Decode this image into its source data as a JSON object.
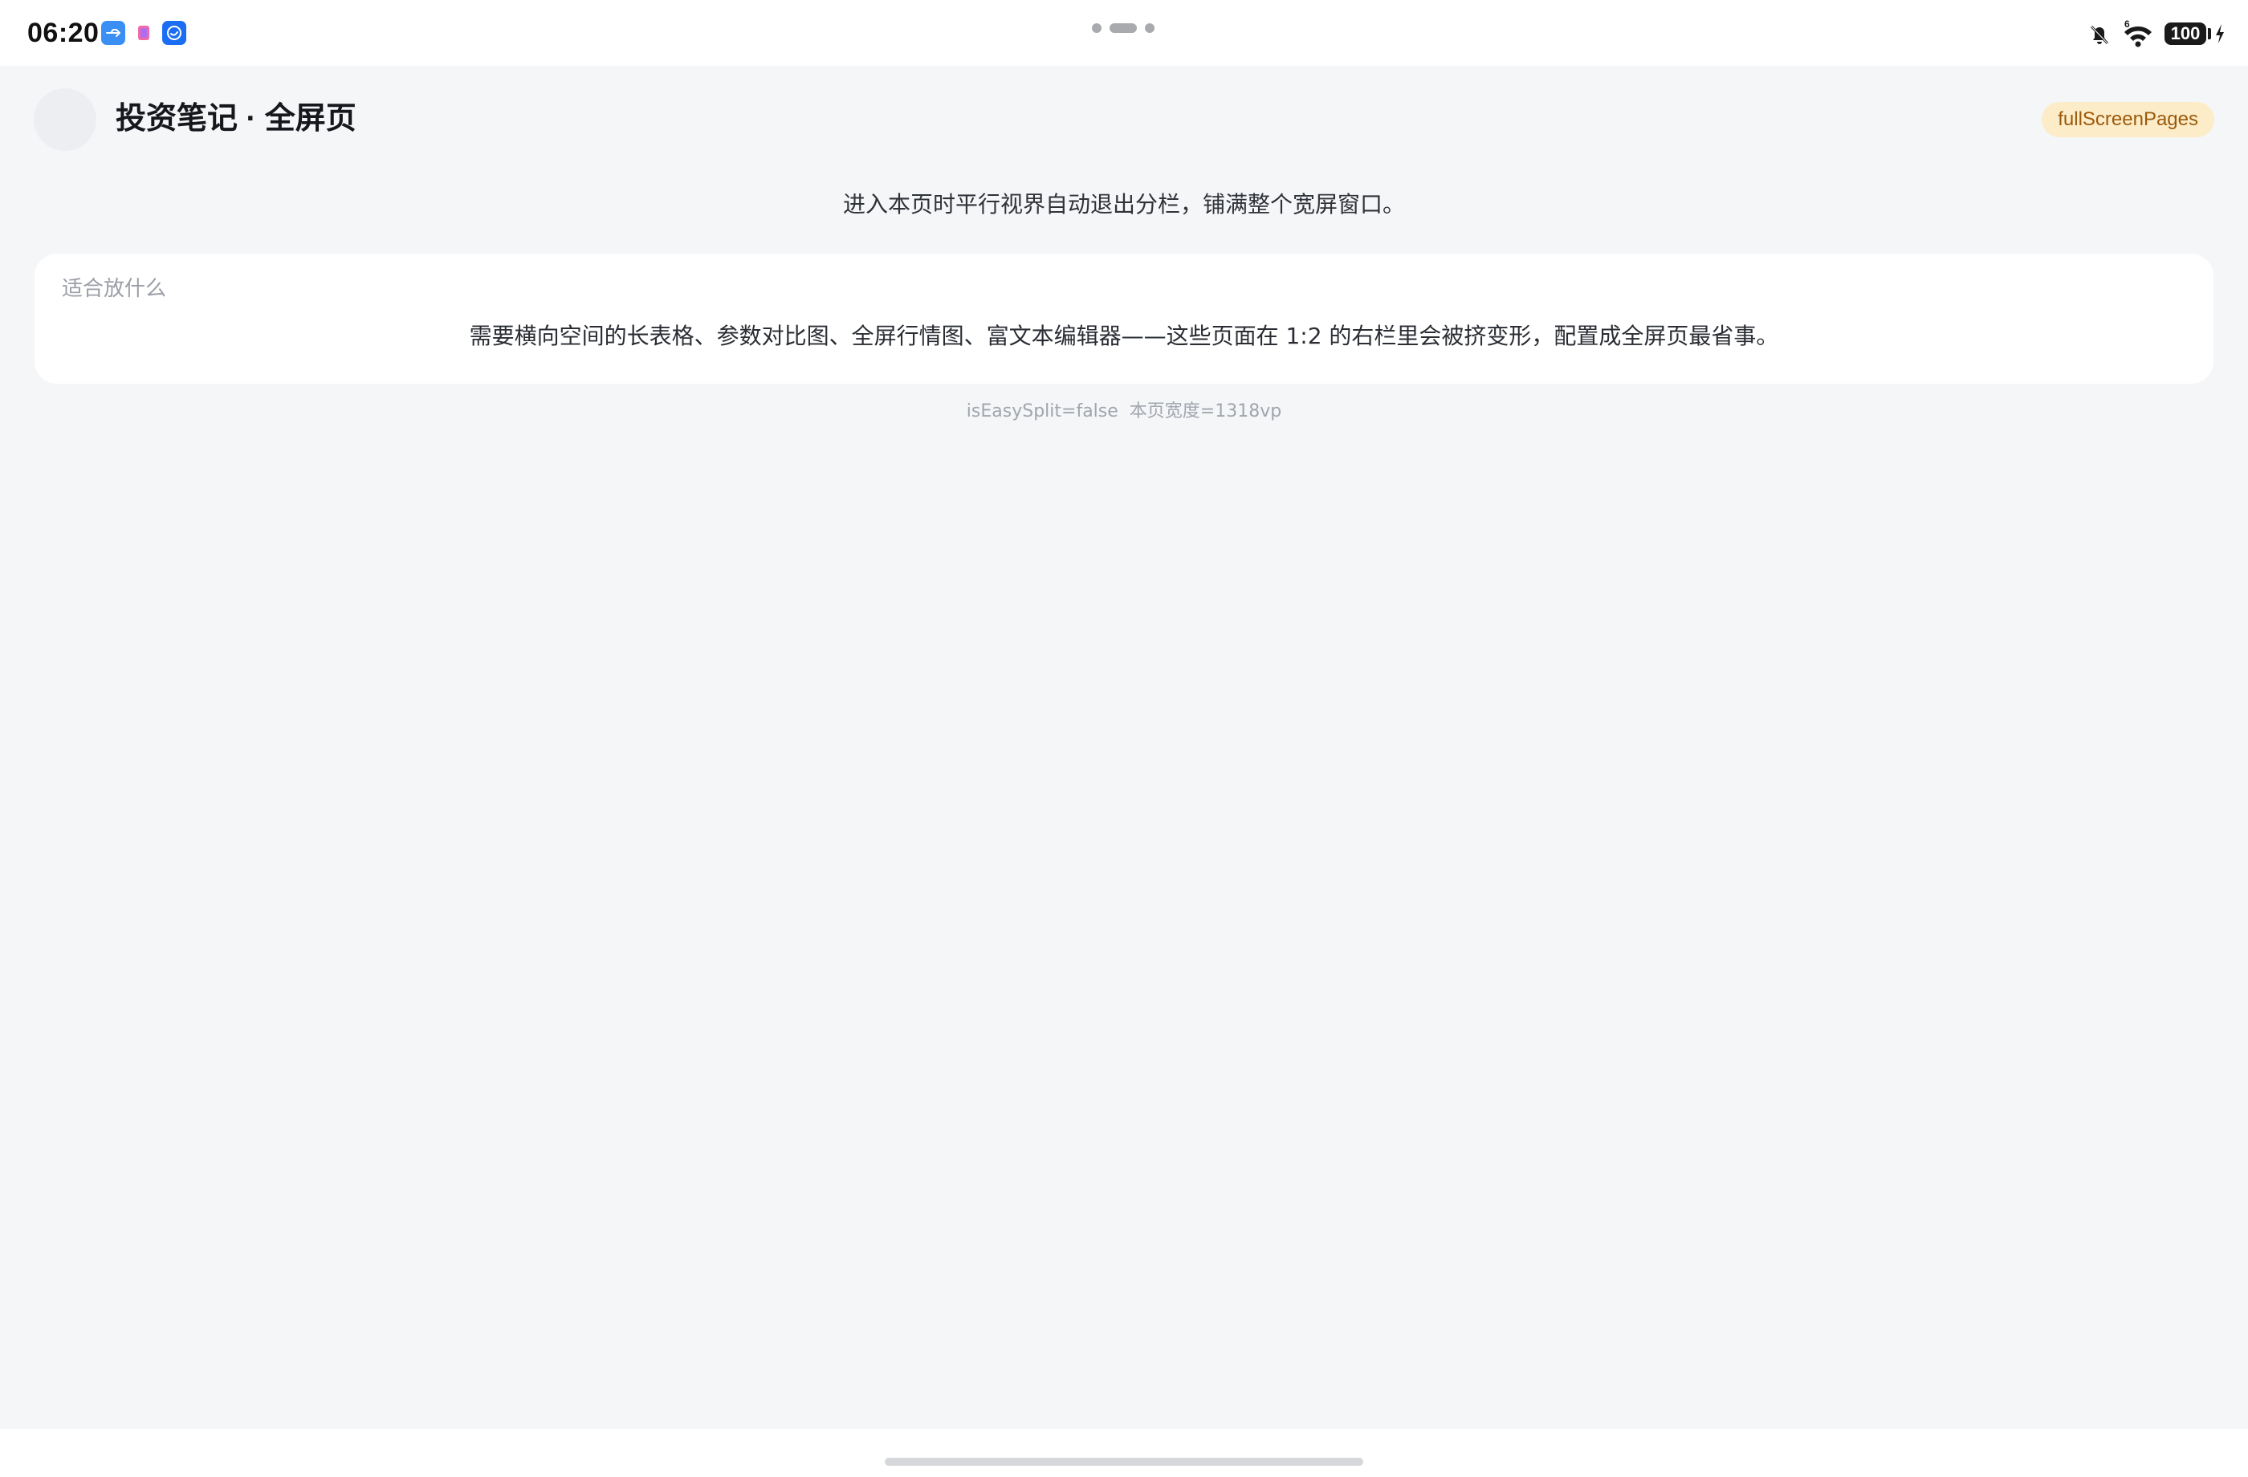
{
  "status_bar": {
    "time": "06:20",
    "app_icons": [
      "usb-app-icon",
      "gallery-app-icon",
      "assistant-app-icon"
    ],
    "right_icons": [
      "bell-off-icon",
      "wifi-icon"
    ],
    "wifi_label": "6",
    "battery": "100",
    "charging": true
  },
  "header": {
    "title": "投资笔记 · 全屏页",
    "badge": "fullScreenPages"
  },
  "main": {
    "subtitle": "进入本页时平行视界自动退出分栏，铺满整个宽屏窗口。",
    "card": {
      "label": "适合放什么",
      "body": "需要横向空间的长表格、参数对比图、全屏行情图、富文本编辑器——这些页面在 1:2 的右栏里会被挤变形，配置成全屏页最省事。"
    },
    "footnote": "isEasySplit=false  本页宽度=1318vp"
  },
  "colors": {
    "background": "#f5f6f8",
    "card": "#ffffff",
    "badge_bg": "#fdecc8",
    "badge_text": "#9a5a0c",
    "title": "#15171c"
  }
}
